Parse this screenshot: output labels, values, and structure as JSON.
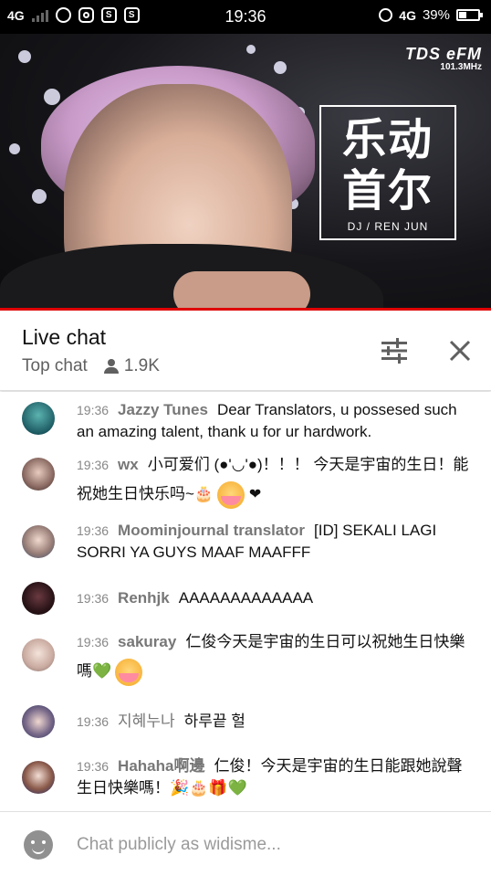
{
  "status_bar": {
    "network_left": "4G",
    "app_icon_letters": [
      "S",
      "S"
    ],
    "time": "19:36",
    "network_right": "4G",
    "battery_percent_label": "39%",
    "battery_level": 0.39
  },
  "video": {
    "logo_lines": [
      "乐动",
      "首尔"
    ],
    "logo_dj": "DJ / REN JUN",
    "brand_name": "TDS eFM",
    "brand_frequency": "101.3MHz",
    "accent_color": "#e00000"
  },
  "chat_header": {
    "title": "Live chat",
    "mode": "Top chat",
    "viewers": "1.9K"
  },
  "messages": [
    {
      "time": "19:36",
      "author": "Jazzy Tunes",
      "text": "Dear Translators, u possesed such an amazing talent, thank u for ur hardwork."
    },
    {
      "time": "19:36",
      "author": "wx",
      "text": "小可爱们 (●'◡'●)！！！ 今天是宇宙的生日！能祝她生日快乐吗~🎂",
      "trail": "❤"
    },
    {
      "time": "19:36",
      "author": "Moominjournal translator",
      "text": "[ID] SEKALI LAGI SORRI YA GUYS MAAF MAAFFF"
    },
    {
      "time": "19:36",
      "author": "Renhjk",
      "text": "AAAAAAAAAAAAA"
    },
    {
      "time": "19:36",
      "author": "sakuray",
      "text": "仁俊今天是宇宙的生日可以祝她生日快樂嗎💚"
    },
    {
      "time": "19:36",
      "author": "지혜누나",
      "text": "하루끝 헐"
    },
    {
      "time": "19:36",
      "author": "Hahaha啊邊",
      "text": "仁俊！今天是宇宙的生日能跟她說聲生日快樂嗎！🎉🎂🎁💚"
    }
  ],
  "input": {
    "placeholder": "Chat publicly as widisme..."
  }
}
